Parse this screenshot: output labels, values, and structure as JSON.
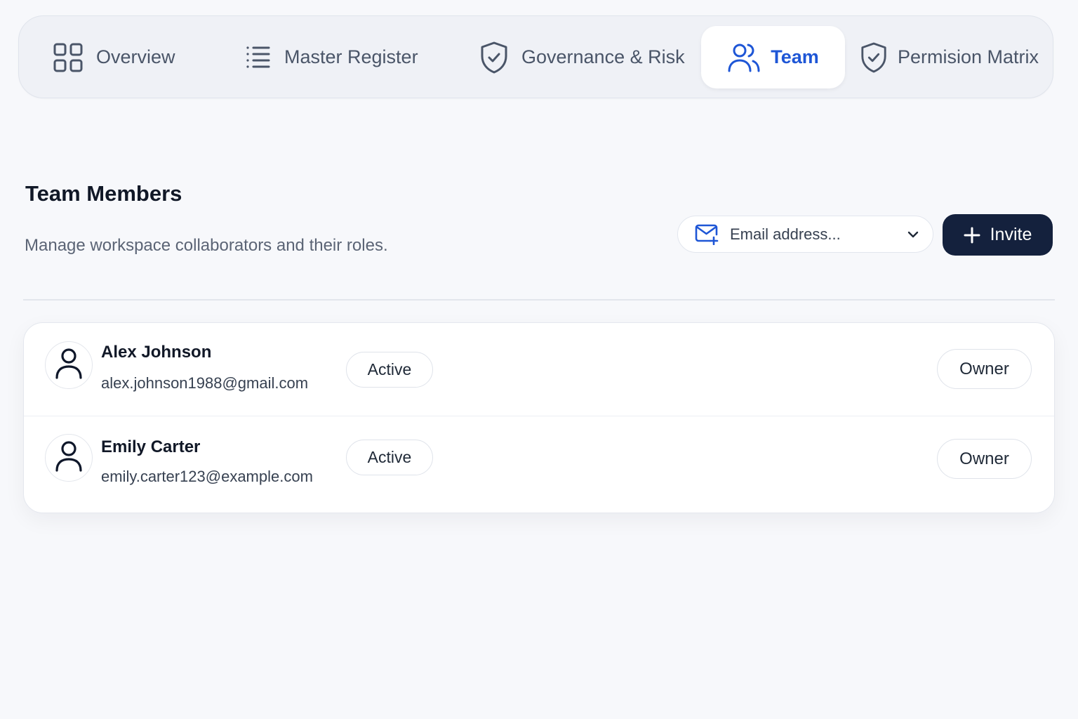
{
  "tabs": [
    {
      "label": "Overview",
      "icon": "grid-icon"
    },
    {
      "label": "Master Register",
      "icon": "list-icon"
    },
    {
      "label": "Governance & Risk",
      "icon": "shield-check-icon"
    },
    {
      "label": "Team",
      "icon": "users-icon",
      "active": true
    },
    {
      "label": "Permision Matrix",
      "icon": "shield-check-icon"
    }
  ],
  "header": {
    "title": "Team Members",
    "subtitle": "Manage workspace collaborators and their roles."
  },
  "invite": {
    "email_placeholder": "Email address...",
    "button_label": "Invite"
  },
  "members": [
    {
      "name": "Alex Johnson",
      "email": "alex.johnson1988@gmail.com",
      "status": "Active",
      "role": "Owner"
    },
    {
      "name": "Emily Carter",
      "email": "emily.carter123@example.com",
      "status": "Active",
      "role": "Owner"
    }
  ],
  "colors": {
    "accent": "#1e56d6",
    "primary_button": "#14213d",
    "tab_bar_bg": "#eff1f6",
    "page_bg": "#f7f8fb"
  }
}
